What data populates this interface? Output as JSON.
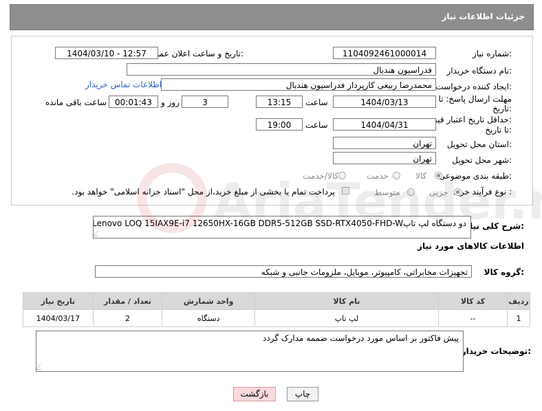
{
  "header": {
    "title": "جزئیات اطلاعات نیاز"
  },
  "fields": {
    "need_number": {
      "label": "شماره نیاز:",
      "value": "1104092461000014"
    },
    "announce": {
      "label": "تاریخ و ساعت اعلان عمومی:",
      "value": "1404/03/10 - 12:57"
    },
    "buyer_org": {
      "label": "نام دستگاه خریدار:",
      "value": "فدراسیون هندبال"
    },
    "creator": {
      "label": "ایجاد کننده درخواست:",
      "value": "محمدرضا ربیعی کارپرداز فدراسیون هندبال",
      "contact_link": "اطلاعات تماس خریدار"
    },
    "reply_deadline": {
      "label_line1": "مهلت ارسال پاسخ: تا",
      "label_line2": "تاریخ:",
      "date": "1404/03/13",
      "time_label": "ساعت",
      "time": "13:15",
      "days": "3",
      "days_label": "روز و",
      "remaining": "00:01:43",
      "remaining_label": "ساعت باقی مانده"
    },
    "price_validity": {
      "label_line1": "حداقل تاریخ اعتبار قیمت:",
      "label_line2": "تا تاریخ:",
      "date": "1404/04/31",
      "time_label": "ساعت",
      "time": "19:00"
    },
    "delivery_province": {
      "label": "استان محل تحویل:",
      "value": "تهران"
    },
    "delivery_city": {
      "label": "شهر محل تحویل:",
      "value": "تهران"
    },
    "category": {
      "label": "طبقه بندی موضوعی:",
      "options": [
        "کالا",
        "خدمت",
        "کالا/خدمت"
      ],
      "selected": "کالا"
    },
    "purchase_type": {
      "label": "نوع فرآیند خرید :",
      "options": [
        "جزیی",
        "متوسط"
      ],
      "selected": "جزیی",
      "payment_note": "پرداخت تمام یا بخشی از مبلغ خرید،از محل \"اسناد خزانه اسلامی\" خواهد بود."
    }
  },
  "description": {
    "label": "شرح کلی نیاز:",
    "value": "دو دستگاه لپ تاپLenovo LOQ 15IAX9E-i7 12650HX-16GB DDR5-512GB SSD-RTX4050-FHD-W"
  },
  "goods_section": {
    "title": "اطلاعات کالاهای مورد نیاز",
    "group_label": "گروه کالا:",
    "group_value": "تجهیزات مخابراتی، کامپیوتر، موبایل، ملزومات جانبی و شبکه"
  },
  "table": {
    "headers": [
      "ردیف",
      "کد کالا",
      "نام کالا",
      "واحد شمارش",
      "تعداد / مقدار",
      "تاریخ نیاز"
    ],
    "rows": [
      [
        "1",
        "--",
        "لپ تاپ",
        "دستگاه",
        "2",
        "1404/03/17"
      ]
    ]
  },
  "buyer_notes": {
    "label": "توضیحات خریدار:",
    "value": "پیش فاکتور بر اساس مورد درخواست ضممه مدارک گردد"
  },
  "buttons": {
    "print": "چاپ",
    "back": "بازگشت"
  },
  "watermark": {
    "text": "AriaTender.neT"
  }
}
